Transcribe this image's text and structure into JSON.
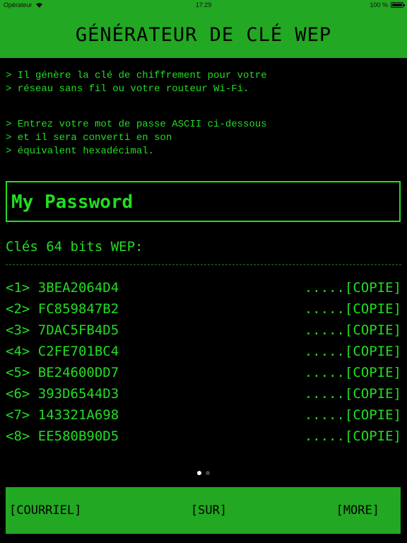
{
  "status_bar": {
    "carrier": "Opérateur",
    "time": "17:29",
    "battery_text": "100 %"
  },
  "header": {
    "title": "GÉNÉRATEUR DE CLÉ WEP"
  },
  "intro": {
    "lines_1": [
      "> Il génère la clé de chiffrement pour votre",
      "> réseau sans fil ou votre routeur Wi-Fi."
    ],
    "lines_2": [
      "> Entrez votre mot de passe ASCII ci-dessous",
      "> et il sera converti en son",
      "> équivalent hexadécimal."
    ]
  },
  "password": {
    "value": "My Password",
    "placeholder": ""
  },
  "keys": {
    "title": "Clés 64 bits WEP:",
    "copy_label": ".....[COPIE]",
    "items": [
      {
        "index": "<1>",
        "value": "3BEA2064D4"
      },
      {
        "index": "<2>",
        "value": "FC859847B2"
      },
      {
        "index": "<3>",
        "value": "7DAC5FB4D5"
      },
      {
        "index": "<4>",
        "value": "C2FE701BC4"
      },
      {
        "index": "<5>",
        "value": "BE24600DD7"
      },
      {
        "index": "<6>",
        "value": "393D6544D3"
      },
      {
        "index": "<7>",
        "value": "143321A698"
      },
      {
        "index": "<8>",
        "value": "EE580B90D5"
      }
    ]
  },
  "pager": {
    "page_count": 2,
    "current_page": 1
  },
  "bottom_bar": {
    "email_label": "[COURRIEL]",
    "about_label": "[SUR]",
    "more_label": "[MORE]"
  },
  "colors": {
    "accent_green": "#22a822",
    "text_green": "#22dd22",
    "background": "#000000"
  }
}
